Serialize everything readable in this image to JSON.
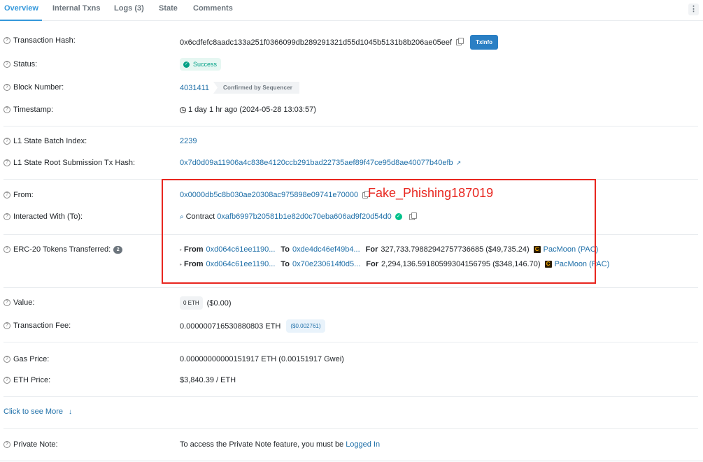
{
  "tabs": [
    {
      "label": "Overview",
      "active": true
    },
    {
      "label": "Internal Txns",
      "active": false
    },
    {
      "label": "Logs (3)",
      "active": false
    },
    {
      "label": "State",
      "active": false
    },
    {
      "label": "Comments",
      "active": false
    }
  ],
  "more_menu": {
    "icon": "more-vertical-icon",
    "glyph": "⋮"
  },
  "help_glyph": "?",
  "rows": {
    "tx_hash": {
      "label": "Transaction Hash:",
      "value": "0x6cdfefc8aadc133a251f0366099db289291321d55d1045b5131b8b206ae05eef",
      "button": "TxInfo"
    },
    "status": {
      "label": "Status:",
      "value": "Success",
      "icon_glyph": "✓"
    },
    "block": {
      "label": "Block Number:",
      "value": "4031411",
      "badge": "Confirmed by Sequencer"
    },
    "timestamp": {
      "label": "Timestamp:",
      "value": "1 day 1 hr ago (2024-05-28 13:03:57)"
    },
    "batch_index": {
      "label": "L1 State Batch Index:",
      "value": "2239"
    },
    "root_tx": {
      "label": "L1 State Root Submission Tx Hash:",
      "value": "0x7d0d09a11906a4c838e4120ccb291bad22735aef89f47ce95d8ae40077b40efb",
      "icon_glyph": "↗"
    },
    "from": {
      "label": "From:",
      "value": "0x0000db5c8b030ae20308ac975898e09741e70000"
    },
    "to": {
      "label": "Interacted With (To):",
      "prefix": "Contract",
      "value": "0xafb6997b20581b1e82d0c70eba606ad9f20d54d0",
      "search_glyph": "⌕",
      "verified_glyph": "✓"
    },
    "erc20": {
      "label": "ERC-20 Tokens Transferred:",
      "count": "2",
      "caret_glyph": "▸",
      "from_kw": "From",
      "to_kw": "To",
      "for_kw": "For",
      "token_glyph": "C",
      "transfers": [
        {
          "from": "0xd064c61ee1190...",
          "to": "0xde4dc46ef49b4...",
          "amount": "327,733.79882942757736685 ($49,735.24)",
          "token": "PacMoon (PAC)"
        },
        {
          "from": "0xd064c61ee1190...",
          "to": "0x70e230614f0d5...",
          "amount": "2,294,136.59180599304156795 ($348,146.70)",
          "token": "PacMoon (PAC)"
        }
      ]
    },
    "value": {
      "label": "Value:",
      "badge": "0 ETH",
      "usd": "($0.00)"
    },
    "fee": {
      "label": "Transaction Fee:",
      "value": "0.000000716530880803 ETH",
      "usd": "($0.002761)"
    },
    "gas_price": {
      "label": "Gas Price:",
      "value": "0.00000000000151917 ETH (0.00151917 Gwei)"
    },
    "eth_price": {
      "label": "ETH Price:",
      "value": "$3,840.39 / ETH"
    },
    "private_note": {
      "label": "Private Note:",
      "text": "To access the Private Note feature, you must be",
      "link": "Logged In"
    }
  },
  "see_more": {
    "label": "Click to see More",
    "arrow_glyph": "↓"
  },
  "annotation": {
    "text": "Fake_Phishing187019",
    "color": "#e8261f"
  }
}
